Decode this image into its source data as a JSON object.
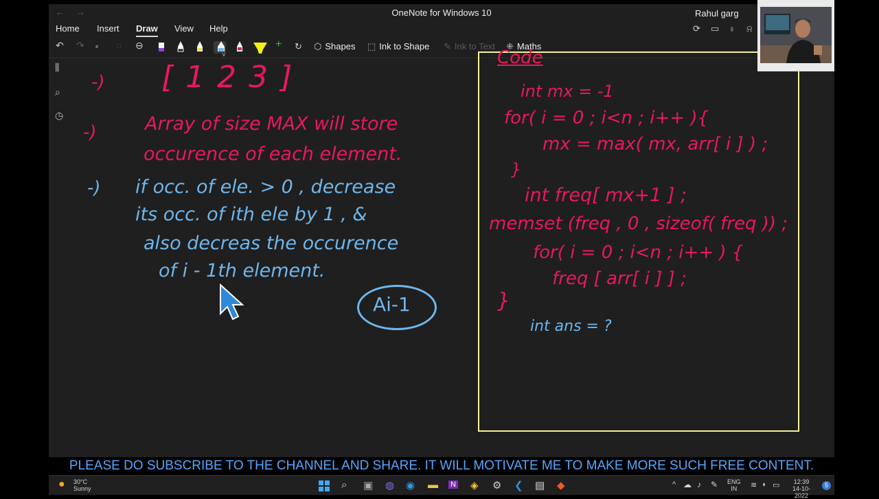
{
  "app": {
    "title": "OneNote for Windows 10",
    "user": "Rahul garg"
  },
  "nav": {
    "back": "←",
    "forward": "→"
  },
  "menu": [
    "Home",
    "Insert",
    "Draw",
    "View",
    "Help"
  ],
  "menu_active": "Draw",
  "menu_right_icons": [
    "sync-icon",
    "immersive-reader-icon",
    "lightbulb-icon",
    "bell-icon"
  ],
  "toolbar": {
    "undo": "↶",
    "redo": "↷",
    "shapes": "Shapes",
    "ink_to_shape": "Ink to Shape",
    "ink_to_text": "Ink to Text",
    "maths": "Maths",
    "add_pen": "+"
  },
  "pens": [
    {
      "color": "#f3f3f3",
      "band": "#9b3ad8"
    },
    {
      "color": "#f3f3f3",
      "band": "#1f1f1f"
    },
    {
      "color": "#f3f3f3",
      "band": "#e6e64a"
    },
    {
      "color": "#f3f3f3",
      "band": "#6fb6ec"
    },
    {
      "color": "#f3f3f3",
      "band": "#e8195b"
    },
    {
      "color": "#f5ee1a",
      "band": "#f5ee1a"
    }
  ],
  "colors": {
    "pink_ink": "#e8195b",
    "blue_ink": "#6fb6ec",
    "code_box": "#f5f29a",
    "banner_text": "#58a6ff"
  },
  "notes": {
    "array_arrow": "-)",
    "array": "[ 1   2   3 ]",
    "arrow2": "-)",
    "line1": "Array of size MAX  will store",
    "line2": "occurence of each element.",
    "arrow3": "-)",
    "b1": "if occ. of ele. > 0 ,  decrease",
    "b2": "its occ. of ith ele by 1 , &",
    "b3": "also decreas the occurence",
    "b4": "of       i - 1th  element.",
    "circled": "Ai-1"
  },
  "code": {
    "heading": "Code",
    "c1": "int mx = -1",
    "c2": "for( i = 0 ; i<n ; i++ ){",
    "c3": "mx = max( mx, arr[ i ] ) ;",
    "c4": "}",
    "c5": "int freq[ mx+1 ] ;",
    "c6": "memset (freq , 0 , sizeof( freq )) ;",
    "c7": "for( i = 0 ; i<n ; i++ ) {",
    "c8": "freq [ arr[ i ] ] ;",
    "c9": "}",
    "c10": "int ans = ?"
  },
  "banner": "PLEASE DO SUBSCRIBE TO THE CHANNEL AND SHARE. IT WILL MOTIVATE ME TO MAKE MORE SUCH FREE CONTENT.",
  "taskbar": {
    "weather_temp": "30°C",
    "weather_desc": "Sunny",
    "lang": "ENG",
    "region": "IN",
    "time": "12:39",
    "date": "14-10-2022",
    "notifications": "5"
  }
}
